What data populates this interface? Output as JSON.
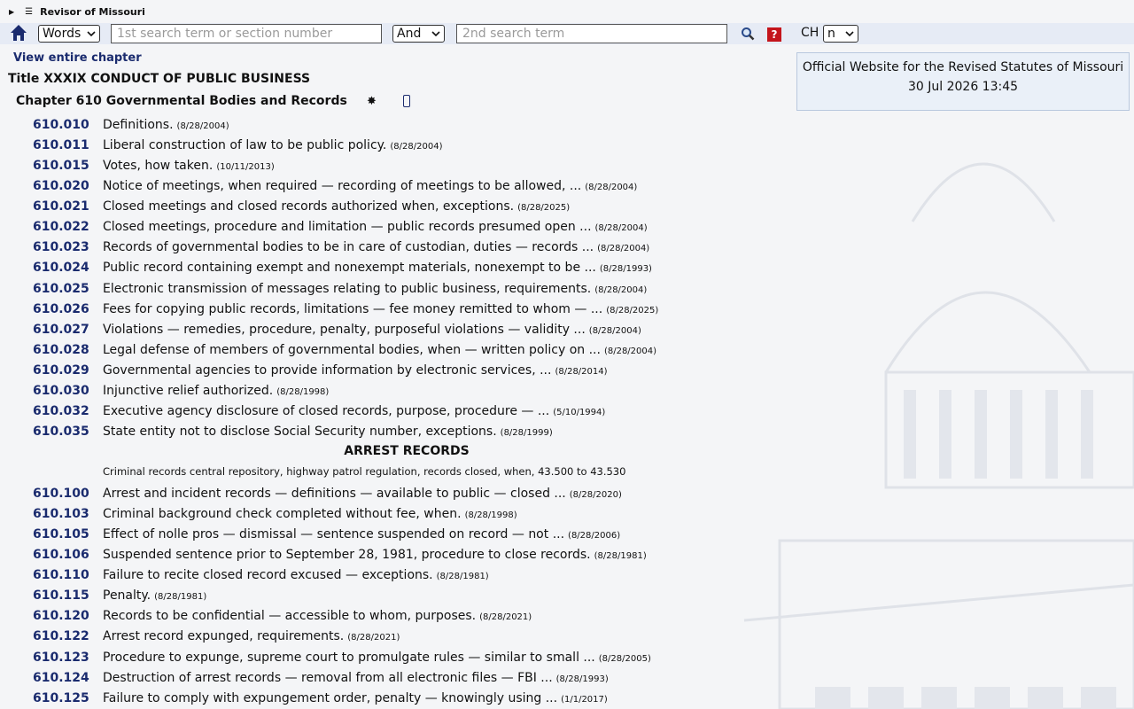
{
  "site": {
    "name": "Revisor of Missouri"
  },
  "search": {
    "type_value": "Words",
    "term1_placeholder": "1st search term or section number",
    "operator_value": "And",
    "term2_placeholder": "2nd search term",
    "help_label": "?",
    "ch_label": "CH",
    "ch_value": "n"
  },
  "official": {
    "text": "Official Website for the Revised Statutes of Missouri",
    "date": "30 Jul 2026 13:45"
  },
  "chapter": {
    "view_link": "View entire chapter",
    "title": "Title XXXIX CONDUCT OF PUBLIC BUSINESS",
    "heading": "Chapter 610 Governmental Bodies and Records",
    "star": "✸"
  },
  "sections": [
    {
      "num": "610.010",
      "text": "Definitions.",
      "date": "(8/28/2004)"
    },
    {
      "num": "610.011",
      "text": "Liberal construction of law to be public policy.",
      "date": "(8/28/2004)"
    },
    {
      "num": "610.015",
      "text": "Votes, how taken.",
      "date": "(10/11/2013)"
    },
    {
      "num": "610.020",
      "text": "Notice of meetings, when required — recording of meetings to be allowed, ...",
      "date": "(8/28/2004)"
    },
    {
      "num": "610.021",
      "text": "Closed meetings and closed records authorized when, exceptions.",
      "date": "(8/28/2025)"
    },
    {
      "num": "610.022",
      "text": "Closed meetings, procedure and limitation — public records presumed open ...",
      "date": "(8/28/2004)"
    },
    {
      "num": "610.023",
      "text": "Records of governmental bodies to be in care of custodian, duties — records ...",
      "date": "(8/28/2004)"
    },
    {
      "num": "610.024",
      "text": "Public record containing exempt and nonexempt materials, nonexempt to be ...",
      "date": "(8/28/1993)"
    },
    {
      "num": "610.025",
      "text": "Electronic transmission of messages relating to public business, requirements.",
      "date": "(8/28/2004)"
    },
    {
      "num": "610.026",
      "text": "Fees for copying public records, limitations — fee money remitted to whom — ...",
      "date": "(8/28/2025)"
    },
    {
      "num": "610.027",
      "text": "Violations — remedies, procedure, penalty, purposeful violations — validity ...",
      "date": "(8/28/2004)"
    },
    {
      "num": "610.028",
      "text": "Legal defense of members of governmental bodies, when — written policy on ...",
      "date": "(8/28/2004)"
    },
    {
      "num": "610.029",
      "text": "Governmental agencies to provide information by electronic services, ...",
      "date": "(8/28/2014)"
    },
    {
      "num": "610.030",
      "text": "Injunctive relief authorized.",
      "date": "(8/28/1998)"
    },
    {
      "num": "610.032",
      "text": "Executive agency disclosure of closed records, purpose, procedure — ...",
      "date": "(5/10/1994)"
    },
    {
      "num": "610.035",
      "text": "State entity not to disclose Social Security number, exceptions.",
      "date": "(8/28/1999)"
    }
  ],
  "arrest": {
    "heading": "ARREST RECORDS",
    "note": "Criminal records central repository, highway patrol regulation, records closed, when, 43.500 to 43.530"
  },
  "arrest_sections": [
    {
      "num": "610.100",
      "text": "Arrest and incident records — definitions — available to public — closed ...",
      "date": "(8/28/2020)"
    },
    {
      "num": "610.103",
      "text": "Criminal background check completed without fee, when.",
      "date": "(8/28/1998)"
    },
    {
      "num": "610.105",
      "text": "Effect of nolle pros — dismissal — sentence suspended on record — not ...",
      "date": "(8/28/2006)"
    },
    {
      "num": "610.106",
      "text": "Suspended sentence prior to September 28, 1981, procedure to close records.",
      "date": "(8/28/1981)"
    },
    {
      "num": "610.110",
      "text": "Failure to recite closed record excused — exceptions.",
      "date": "(8/28/1981)"
    },
    {
      "num": "610.115",
      "text": "Penalty.",
      "date": "(8/28/1981)"
    },
    {
      "num": "610.120",
      "text": "Records to be confidential — accessible to whom, purposes.",
      "date": "(8/28/2021)"
    },
    {
      "num": "610.122",
      "text": "Arrest record expunged, requirements.",
      "date": "(8/28/2021)"
    },
    {
      "num": "610.123",
      "text": "Procedure to expunge, supreme court to promulgate rules — similar to small ...",
      "date": "(8/28/2005)"
    },
    {
      "num": "610.124",
      "text": "Destruction of arrest records — removal from all electronic files — FBI ...",
      "date": "(8/28/1993)"
    },
    {
      "num": "610.125",
      "text": "Failure to comply with expungement order, penalty — knowingly using ...",
      "date": "(1/1/2017)"
    }
  ]
}
